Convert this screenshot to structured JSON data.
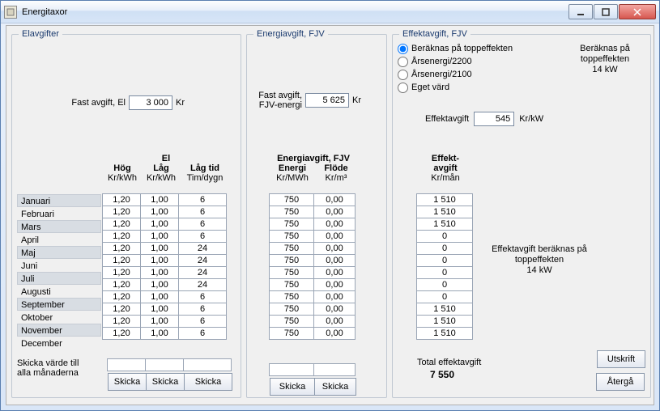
{
  "window": {
    "title": "Energitaxor"
  },
  "groups": {
    "el": "Elavgifter",
    "fjv": "Energiavgift, FJV",
    "eff": "Effektavgift, FJV"
  },
  "el": {
    "fast_label": "Fast avgift, El",
    "fast_value": "3 000",
    "fast_unit": "Kr",
    "header_top": "El",
    "headers": {
      "hog": "Hög",
      "lag": "Låg",
      "lagtid": "Låg tid"
    },
    "units": {
      "hog": "Kr/kWh",
      "lag": "Kr/kWh",
      "lagtid": "Tim/dygn"
    }
  },
  "fjv": {
    "fast_label1": "Fast avgift,",
    "fast_label2": "FJV-energi",
    "fast_value": "5 625",
    "fast_unit": "Kr",
    "header_top": "Energiavgift, FJV",
    "headers": {
      "energi": "Energi",
      "flode": "Flöde"
    },
    "units": {
      "energi": "Kr/MWh",
      "flode": "Kr/m³"
    }
  },
  "eff": {
    "radios": {
      "r1": "Beräknas på toppeffekten",
      "r2": "Årsenergi/2200",
      "r3": "Årsenergi/2100",
      "r4": "Eget värd"
    },
    "calc_note1": "Beräknas på toppeffekten",
    "calc_note2": "14 kW",
    "input_label": "Effektavgift",
    "input_value": "545",
    "input_unit": "Kr/kW",
    "header_top1": "Effekt-",
    "header_top2": "avgift",
    "header_unit": "Kr/mån",
    "note1": "Effektavgift beräknas på toppeffekten",
    "note2": "14 kW",
    "total_label": "Total effektavgift",
    "total_value": "7 550"
  },
  "months": [
    {
      "name": "Januari",
      "shade": true
    },
    {
      "name": "Februari",
      "shade": false
    },
    {
      "name": "Mars",
      "shade": true
    },
    {
      "name": "April",
      "shade": false
    },
    {
      "name": "Maj",
      "shade": true
    },
    {
      "name": "Juni",
      "shade": false
    },
    {
      "name": "Juli",
      "shade": true
    },
    {
      "name": "Augusti",
      "shade": false
    },
    {
      "name": "September",
      "shade": true
    },
    {
      "name": "Oktober",
      "shade": false
    },
    {
      "name": "November",
      "shade": true
    },
    {
      "name": "December",
      "shade": false
    }
  ],
  "rows": [
    {
      "hog": "1,20",
      "lag": "1,00",
      "lt": "6",
      "en": "750",
      "fl": "0,00",
      "ea": "1 510"
    },
    {
      "hog": "1,20",
      "lag": "1,00",
      "lt": "6",
      "en": "750",
      "fl": "0,00",
      "ea": "1 510"
    },
    {
      "hog": "1,20",
      "lag": "1,00",
      "lt": "6",
      "en": "750",
      "fl": "0,00",
      "ea": "1 510"
    },
    {
      "hog": "1,20",
      "lag": "1,00",
      "lt": "6",
      "en": "750",
      "fl": "0,00",
      "ea": "0"
    },
    {
      "hog": "1,20",
      "lag": "1,00",
      "lt": "24",
      "en": "750",
      "fl": "0,00",
      "ea": "0"
    },
    {
      "hog": "1,20",
      "lag": "1,00",
      "lt": "24",
      "en": "750",
      "fl": "0,00",
      "ea": "0"
    },
    {
      "hog": "1,20",
      "lag": "1,00",
      "lt": "24",
      "en": "750",
      "fl": "0,00",
      "ea": "0"
    },
    {
      "hog": "1,20",
      "lag": "1,00",
      "lt": "24",
      "en": "750",
      "fl": "0,00",
      "ea": "0"
    },
    {
      "hog": "1,20",
      "lag": "1,00",
      "lt": "6",
      "en": "750",
      "fl": "0,00",
      "ea": "0"
    },
    {
      "hog": "1,20",
      "lag": "1,00",
      "lt": "6",
      "en": "750",
      "fl": "0,00",
      "ea": "1 510"
    },
    {
      "hog": "1,20",
      "lag": "1,00",
      "lt": "6",
      "en": "750",
      "fl": "0,00",
      "ea": "1 510"
    },
    {
      "hog": "1,20",
      "lag": "1,00",
      "lt": "6",
      "en": "750",
      "fl": "0,00",
      "ea": "1 510"
    }
  ],
  "send": {
    "label1": "Skicka värde till",
    "label2": "alla månaderna",
    "btn": "Skicka"
  },
  "buttons": {
    "print": "Utskrift",
    "back": "Återgå"
  }
}
